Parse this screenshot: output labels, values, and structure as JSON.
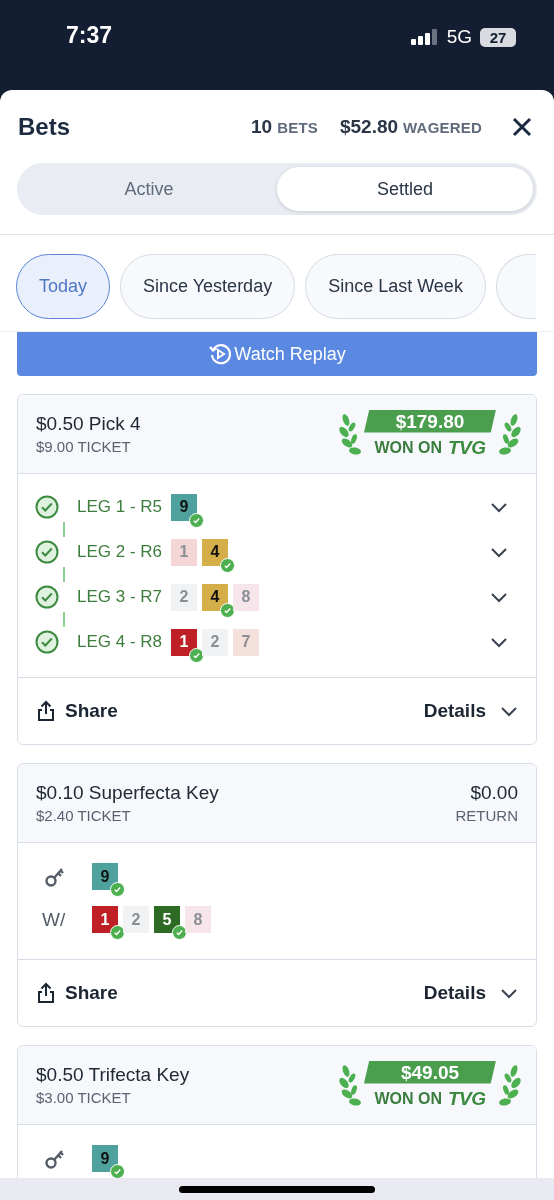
{
  "status_bar": {
    "time": "7:37",
    "network": "5G",
    "battery": "27"
  },
  "sheet": {
    "title": "Bets",
    "bet_count": "10",
    "bet_count_label": "BETS",
    "wagered": "$52.80",
    "wagered_label": "WAGERED"
  },
  "tabs": [
    {
      "label": "Active",
      "selected": false
    },
    {
      "label": "Settled",
      "selected": true
    }
  ],
  "filters": [
    {
      "label": "Today",
      "selected": true
    },
    {
      "label": "Since Yesterday",
      "selected": false
    },
    {
      "label": "Since Last Week",
      "selected": false
    }
  ],
  "replay_button": "Watch Replay",
  "bets": [
    {
      "kind": "pick",
      "title": "$0.50 Pick 4",
      "ticket": "$9.00 TICKET",
      "result": {
        "kind": "won",
        "amount": "$179.80",
        "label": "WON ON",
        "brand": "TVG"
      },
      "legs": [
        {
          "label": "LEG 1 - R5",
          "won": true,
          "runners": [
            {
              "number": "9",
              "color": "#4fa19e",
              "winner": true
            }
          ]
        },
        {
          "label": "LEG 2 - R6",
          "won": true,
          "runners": [
            {
              "number": "1",
              "color": "#f4d6d6",
              "winner": false
            },
            {
              "number": "4",
              "color": "#d4ae48",
              "winner": true
            }
          ]
        },
        {
          "label": "LEG 3 - R7",
          "won": true,
          "runners": [
            {
              "number": "2",
              "color": "#f1f2f4",
              "winner": false
            },
            {
              "number": "4",
              "color": "#d4ae48",
              "winner": true
            },
            {
              "number": "8",
              "color": "#f7e6e9",
              "winner": false
            }
          ]
        },
        {
          "label": "LEG 4 - R8",
          "won": true,
          "runners": [
            {
              "number": "1",
              "color": "#bf2026",
              "winner": true
            },
            {
              "number": "2",
              "color": "#f1f2f4",
              "winner": false
            },
            {
              "number": "7",
              "color": "#f5e1dc",
              "winner": false
            }
          ]
        }
      ],
      "share": "Share",
      "details": "Details"
    },
    {
      "kind": "key",
      "title": "$0.10 Superfecta Key",
      "ticket": "$2.40 TICKET",
      "result": {
        "kind": "return",
        "amount": "$0.00",
        "label": "RETURN"
      },
      "rows": [
        {
          "kind": "key",
          "runners": [
            {
              "number": "9",
              "color": "#4fa19e",
              "winner": true
            }
          ]
        },
        {
          "kind": "with",
          "label": "W/",
          "runners": [
            {
              "number": "1",
              "color": "#bf2026",
              "winner": true
            },
            {
              "number": "2",
              "color": "#f1f2f4",
              "winner": false
            },
            {
              "number": "5",
              "color": "#2d6a24",
              "winner": true
            },
            {
              "number": "8",
              "color": "#f7e6e9",
              "winner": false
            }
          ]
        }
      ],
      "share": "Share",
      "details": "Details"
    },
    {
      "kind": "key",
      "title": "$0.50 Trifecta Key",
      "ticket": "$3.00 TICKET",
      "result": {
        "kind": "won",
        "amount": "$49.05",
        "label": "WON ON",
        "brand": "TVG"
      },
      "rows": [
        {
          "kind": "key",
          "runners": [
            {
              "number": "9",
              "color": "#4fa19e",
              "winner": true
            }
          ]
        }
      ]
    }
  ]
}
